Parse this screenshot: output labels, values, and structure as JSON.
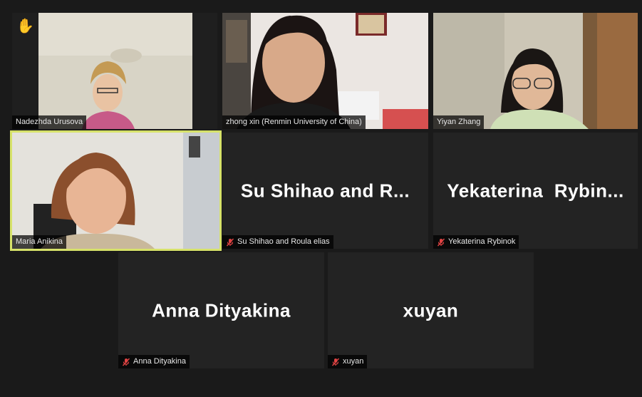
{
  "participants": [
    {
      "name": "Nadezhda Urusova",
      "video": true,
      "raised_hand": true
    },
    {
      "name": "zhong xin (Renmin University of China)",
      "video": true
    },
    {
      "name": "Yiyan Zhang",
      "video": true
    },
    {
      "name": "Maria Anikina",
      "video": true,
      "speaking": true
    },
    {
      "name": "Su Shihao and Roula elias",
      "display": "Su Shihao and R...",
      "video": false,
      "muted": true
    },
    {
      "name": "Yekaterina Rybinok",
      "display": "Yekaterina  Rybin...",
      "video": false,
      "muted": true
    },
    {
      "name": "Anna Dityakina",
      "display": "Anna Dityakina",
      "video": false,
      "muted": true
    },
    {
      "name": "xuyan",
      "display": "xuyan",
      "video": false,
      "muted": true
    }
  ],
  "icons": {
    "raised_hand": "raised-hand-icon",
    "muted": "mic-muted-icon"
  },
  "colors": {
    "active_border": "#d6e26a",
    "muted_icon": "#e04343",
    "hand": "#f2b600"
  }
}
